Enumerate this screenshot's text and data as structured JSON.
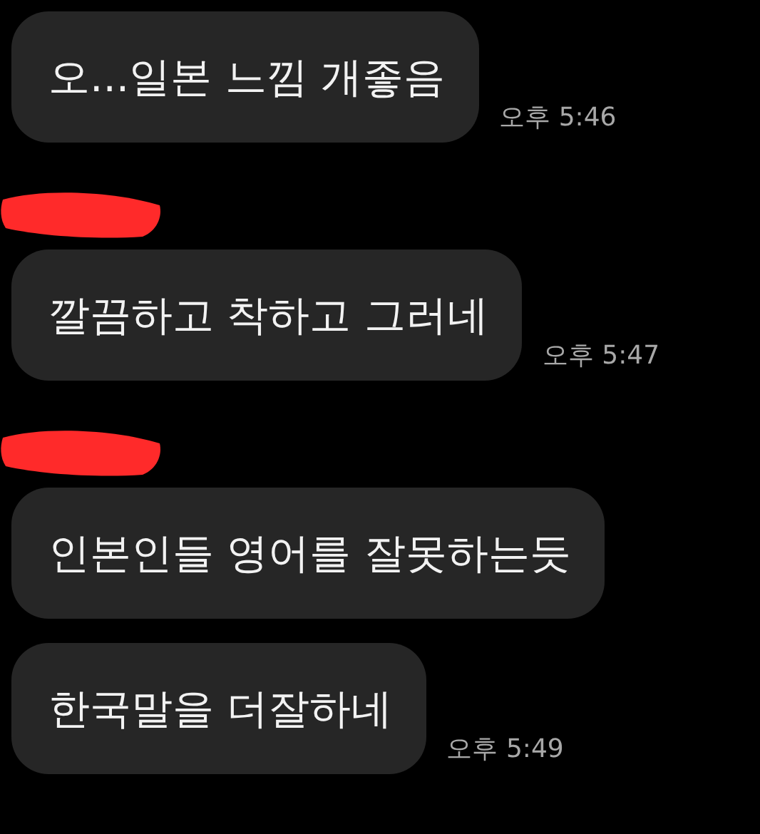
{
  "groups": [
    {
      "sender_redacted": false,
      "messages": [
        {
          "text": "오...일본 느낌 개좋음",
          "time": "오후 5:46"
        }
      ]
    },
    {
      "sender_redacted": true,
      "messages": [
        {
          "text": "깔끔하고 착하고 그러네",
          "time": "오후 5:47"
        }
      ]
    },
    {
      "sender_redacted": true,
      "messages": [
        {
          "text": "인본인들 영어를 잘못하는듯"
        },
        {
          "text": "한국말을 더잘하네",
          "time": "오후 5:49"
        }
      ]
    }
  ]
}
